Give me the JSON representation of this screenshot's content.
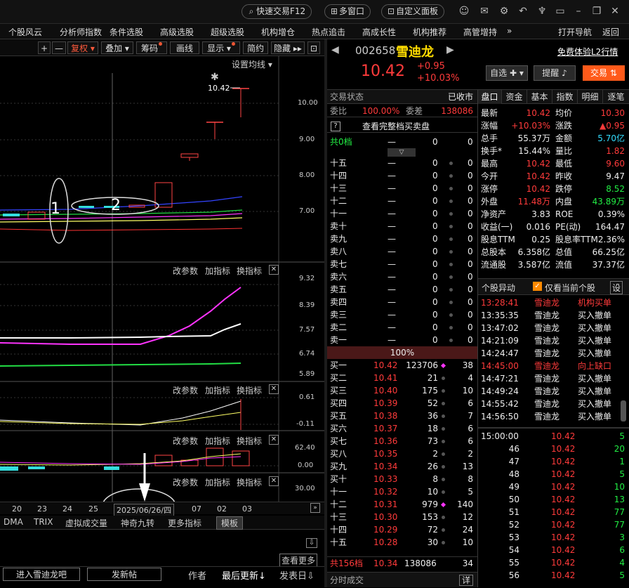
{
  "topbar": {
    "quick_trade": "快速交易F12",
    "multi_window": "多窗口",
    "custom_panel": "自定义面板"
  },
  "menu": [
    "个股风云",
    "分析师指数",
    "条件选股",
    "高级选股",
    "超级选股",
    "机构增仓",
    "热点追击",
    "高成长性",
    "机构推荐",
    "高管增持"
  ],
  "menu_more": "»",
  "menu_nav": "打开导航",
  "menu_back": "返回",
  "toolbar": {
    "plus": "+",
    "minus": "—",
    "fuquan": "复权",
    "diejia": "叠加",
    "chouma": "筹码",
    "huaxian": "画线",
    "xianshi": "显示",
    "jianyue": "简约",
    "yincang": "隐藏"
  },
  "chart": {
    "ma_setting": "设置均线",
    "price_ticks": [
      "10.00",
      "9.00",
      "8.00",
      "7.00"
    ],
    "peak_label": "10.42",
    "ann1": "1",
    "ann2": "2",
    "panel_btns": [
      "改参数",
      "加指标",
      "换指标"
    ],
    "ind1_ticks": [
      "9.32",
      "8.39",
      "7.57",
      "6.74",
      "5.89"
    ],
    "ind2_ticks": [
      "0.61",
      "-0.11"
    ],
    "ind3_ticks": [
      "62.40",
      "0.00"
    ],
    "ind4_ticks": [
      "30.00"
    ],
    "x_ticks": [
      "20",
      "23",
      "24",
      "25",
      "03"
    ],
    "x_ticks_right": [
      "07",
      "02"
    ],
    "x_current": "2025/06/26/四",
    "bottom_tabs": [
      "DMA",
      "TRIX",
      "虚拟成交量",
      "神奇九转",
      "更多指标",
      "模板"
    ],
    "news_more": "查看更多",
    "news_headers": [
      "进入雪迪龙吧",
      "发新帖",
      "作者",
      "最后更新",
      "发表日"
    ]
  },
  "stock": {
    "code": "002658",
    "name": "雪迪龙",
    "price": "10.42",
    "change": "+0.95",
    "pct": "+10.03%",
    "l2": "免费体验L2行情",
    "zixuan": "自选",
    "tixing": "提醒",
    "jiaoyi": "交易"
  },
  "status": {
    "label": "交易状态",
    "value": "已收市",
    "weibi_label": "委比",
    "weibi": "100.00%",
    "weicha_label": "委差",
    "weicha": "138086",
    "full_book": "查看完整档买卖盘",
    "q": "?"
  },
  "gong0": {
    "label": "共0档",
    "dash": "—",
    "v1": "0",
    "v2": "0"
  },
  "asks": [
    {
      "l": "十五",
      "p": "—",
      "v": "0",
      "n": "0"
    },
    {
      "l": "十四",
      "p": "—",
      "v": "0",
      "n": "0"
    },
    {
      "l": "十三",
      "p": "—",
      "v": "0",
      "n": "0"
    },
    {
      "l": "十二",
      "p": "—",
      "v": "0",
      "n": "0"
    },
    {
      "l": "十一",
      "p": "—",
      "v": "0",
      "n": "0"
    },
    {
      "l": "卖十",
      "p": "—",
      "v": "0",
      "n": "0"
    },
    {
      "l": "卖九",
      "p": "—",
      "v": "0",
      "n": "0"
    },
    {
      "l": "卖八",
      "p": "—",
      "v": "0",
      "n": "0"
    },
    {
      "l": "卖七",
      "p": "—",
      "v": "0",
      "n": "0"
    },
    {
      "l": "卖六",
      "p": "—",
      "v": "0",
      "n": "0"
    },
    {
      "l": "卖五",
      "p": "—",
      "v": "0",
      "n": "0"
    },
    {
      "l": "卖四",
      "p": "—",
      "v": "0",
      "n": "0"
    },
    {
      "l": "卖三",
      "p": "—",
      "v": "0",
      "n": "0"
    },
    {
      "l": "卖二",
      "p": "—",
      "v": "0",
      "n": "0"
    },
    {
      "l": "卖一",
      "p": "—",
      "v": "0",
      "n": "0"
    }
  ],
  "pct_bar": "100%",
  "bids": [
    {
      "l": "买一",
      "p": "10.42",
      "v": "123706",
      "n": "38",
      "m": true
    },
    {
      "l": "买二",
      "p": "10.41",
      "v": "21",
      "n": "4"
    },
    {
      "l": "买三",
      "p": "10.40",
      "v": "175",
      "n": "10"
    },
    {
      "l": "买四",
      "p": "10.39",
      "v": "52",
      "n": "6"
    },
    {
      "l": "买五",
      "p": "10.38",
      "v": "36",
      "n": "7"
    },
    {
      "l": "买六",
      "p": "10.37",
      "v": "18",
      "n": "6"
    },
    {
      "l": "买七",
      "p": "10.36",
      "v": "73",
      "n": "6"
    },
    {
      "l": "买八",
      "p": "10.35",
      "v": "2",
      "n": "2"
    },
    {
      "l": "买九",
      "p": "10.34",
      "v": "26",
      "n": "13"
    },
    {
      "l": "买十",
      "p": "10.33",
      "v": "8",
      "n": "8"
    },
    {
      "l": "十一",
      "p": "10.32",
      "v": "10",
      "n": "5"
    },
    {
      "l": "十二",
      "p": "10.31",
      "v": "979",
      "n": "140",
      "m": true
    },
    {
      "l": "十三",
      "p": "10.30",
      "v": "153",
      "n": "12"
    },
    {
      "l": "十四",
      "p": "10.29",
      "v": "72",
      "n": "24"
    },
    {
      "l": "十五",
      "p": "10.28",
      "v": "30",
      "n": "10"
    }
  ],
  "gong156": {
    "label": "共156档",
    "p": "10.34",
    "v": "138086",
    "n": "34"
  },
  "fenshi": {
    "label": "分时成交",
    "btn": "详"
  },
  "rtabs": [
    "盘口",
    "资金",
    "基本",
    "指数",
    "明细",
    "逐笔"
  ],
  "quote": [
    [
      "最新",
      "10.42",
      "red",
      "均价",
      "10.30",
      "red"
    ],
    [
      "涨幅",
      "+10.03%",
      "red",
      "涨跌",
      "▲0.95",
      "red"
    ],
    [
      "总手",
      "55.37万",
      "wht",
      "金额",
      "5.70亿",
      "cyn"
    ],
    [
      "换手*",
      "15.44%",
      "wht",
      "量比",
      "1.82",
      "red"
    ],
    [
      "最高",
      "10.42",
      "red",
      "最低",
      "9.60",
      "red"
    ],
    [
      "今开",
      "10.42",
      "red",
      "昨收",
      "9.47",
      "wht"
    ],
    [
      "涨停",
      "10.42",
      "red",
      "跌停",
      "8.52",
      "grn"
    ],
    [
      "外盘",
      "11.48万",
      "red",
      "内盘",
      "43.89万",
      "grn"
    ],
    [
      "净资产",
      "3.83",
      "wht",
      "ROE",
      "0.39%",
      "wht"
    ],
    [
      "收益(一)",
      "0.016",
      "wht",
      "PE(动)",
      "164.47",
      "wht"
    ],
    [
      "股息TTM",
      "0.25",
      "wht",
      "股息率TTM",
      "2.36%",
      "wht"
    ],
    [
      "总股本",
      "6.358亿",
      "wht",
      "总值",
      "66.25亿",
      "wht"
    ],
    [
      "流通股",
      "3.587亿",
      "wht",
      "流值",
      "37.37亿",
      "wht"
    ]
  ],
  "yidong": {
    "title": "个股异动",
    "only_current": "仅看当前个股",
    "settings": "设",
    "rows": [
      [
        "13:28:41",
        "雪迪龙",
        "机构买单",
        "red"
      ],
      [
        "13:35:35",
        "雪迪龙",
        "买入撤单",
        "wht"
      ],
      [
        "13:47:02",
        "雪迪龙",
        "买入撤单",
        "wht"
      ],
      [
        "14:21:09",
        "雪迪龙",
        "买入撤单",
        "wht"
      ],
      [
        "14:24:47",
        "雪迪龙",
        "买入撤单",
        "wht"
      ],
      [
        "14:45:00",
        "雪迪龙",
        "向上缺口",
        "red"
      ],
      [
        "14:47:21",
        "雪迪龙",
        "买入撤单",
        "wht"
      ],
      [
        "14:49:24",
        "雪迪龙",
        "买入撤单",
        "wht"
      ],
      [
        "14:55:42",
        "雪迪龙",
        "买入撤单",
        "wht"
      ],
      [
        "14:56:50",
        "雪迪龙",
        "买入撤单",
        "wht"
      ]
    ]
  },
  "trades": [
    [
      "15:00:00",
      "10.42",
      "5"
    ],
    [
      "46",
      "10.42",
      "20"
    ],
    [
      "47",
      "10.42",
      "1"
    ],
    [
      "48",
      "10.42",
      "5"
    ],
    [
      "49",
      "10.42",
      "10"
    ],
    [
      "50",
      "10.42",
      "13"
    ],
    [
      "51",
      "10.42",
      "77"
    ],
    [
      "52",
      "10.42",
      "77"
    ],
    [
      "53",
      "10.42",
      "3"
    ],
    [
      "54",
      "10.42",
      "6"
    ],
    [
      "55",
      "10.42",
      "4"
    ],
    [
      "56",
      "10.42",
      "5"
    ]
  ]
}
